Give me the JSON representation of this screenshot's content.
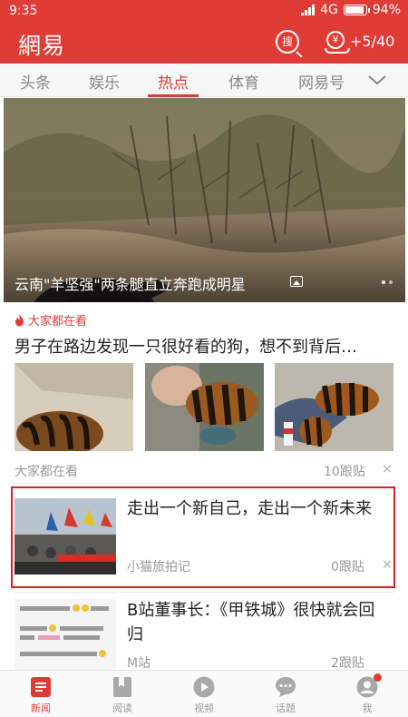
{
  "status_bar": {
    "time": "9:35",
    "network": "4G",
    "battery": "94%",
    "battery_level": 0.94
  },
  "app_bar": {
    "logo": "網易",
    "search_icon_glyph": "搜",
    "coin_glyph": "¥",
    "coin_count": "+5/40"
  },
  "tabs": [
    {
      "label": "头条"
    },
    {
      "label": "娱乐"
    },
    {
      "label": "热点"
    },
    {
      "label": "体育"
    },
    {
      "label": "网易号"
    }
  ],
  "active_tab": "热点",
  "hero": {
    "title": "云南\"羊坚强\"两条腿直立奔跑成明星",
    "slide_count": 2,
    "active_slide": 1
  },
  "hot": {
    "tag": "大家都在看",
    "title": "男子在路边发现一只很好看的狗，想不到背后…",
    "source": "大家都在看",
    "comments": "10跟贴",
    "close": "×"
  },
  "articles": [
    {
      "title": "走出一个新自己，走出一个新未来",
      "source": "小猫旅拍记",
      "comments": "0跟贴",
      "close": "×",
      "highlighted": true
    },
    {
      "title": "B站董事长：《甲铁城》很快就会回归",
      "source": "M站",
      "comments": "2跟贴"
    }
  ],
  "bottom_nav": [
    {
      "label": "新闻",
      "icon": "news-icon",
      "active": true
    },
    {
      "label": "阅读",
      "icon": "book-icon"
    },
    {
      "label": "视频",
      "icon": "play-icon"
    },
    {
      "label": "话题",
      "icon": "chat-icon"
    },
    {
      "label": "我",
      "icon": "profile-icon",
      "badge": true
    }
  ],
  "colors": {
    "brand": "#e13b36",
    "highlight": "#d92222"
  }
}
